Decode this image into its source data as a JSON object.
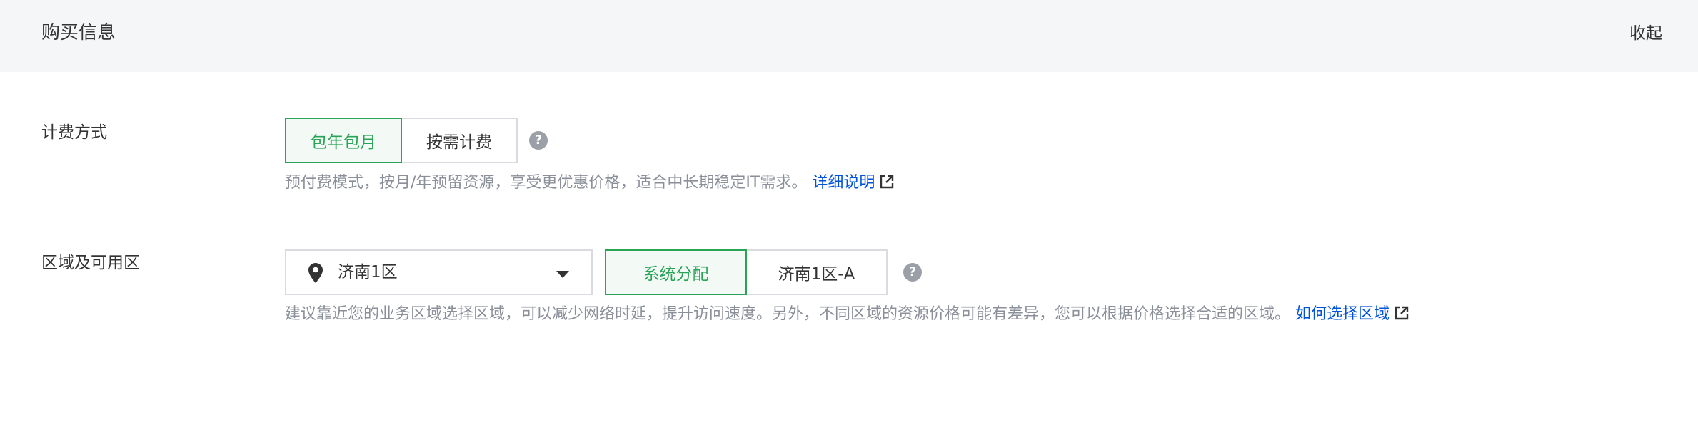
{
  "header": {
    "title": "购买信息",
    "collapse_label": "收起"
  },
  "billing": {
    "label": "计费方式",
    "options": [
      "包年包月",
      "按需计费"
    ],
    "selected": "包年包月",
    "hint": "预付费模式，按月/年预留资源，享受更优惠价格，适合中长期稳定IT需求。",
    "link": "详细说明"
  },
  "region": {
    "label": "区域及可用区",
    "region_value": "济南1区",
    "zone_options": [
      "系统分配",
      "济南1区-A"
    ],
    "selected_zone": "系统分配",
    "hint": "建议靠近您的业务区域选择区域，可以减少网络时延，提升访问速度。另外，不同区域的资源价格可能有差异，您可以根据价格选择合适的区域。",
    "link": "如何选择区域"
  },
  "colors": {
    "accent": "#29a356",
    "link": "#0052d9",
    "muted": "#8a8f99",
    "border": "#d9dbe0"
  }
}
